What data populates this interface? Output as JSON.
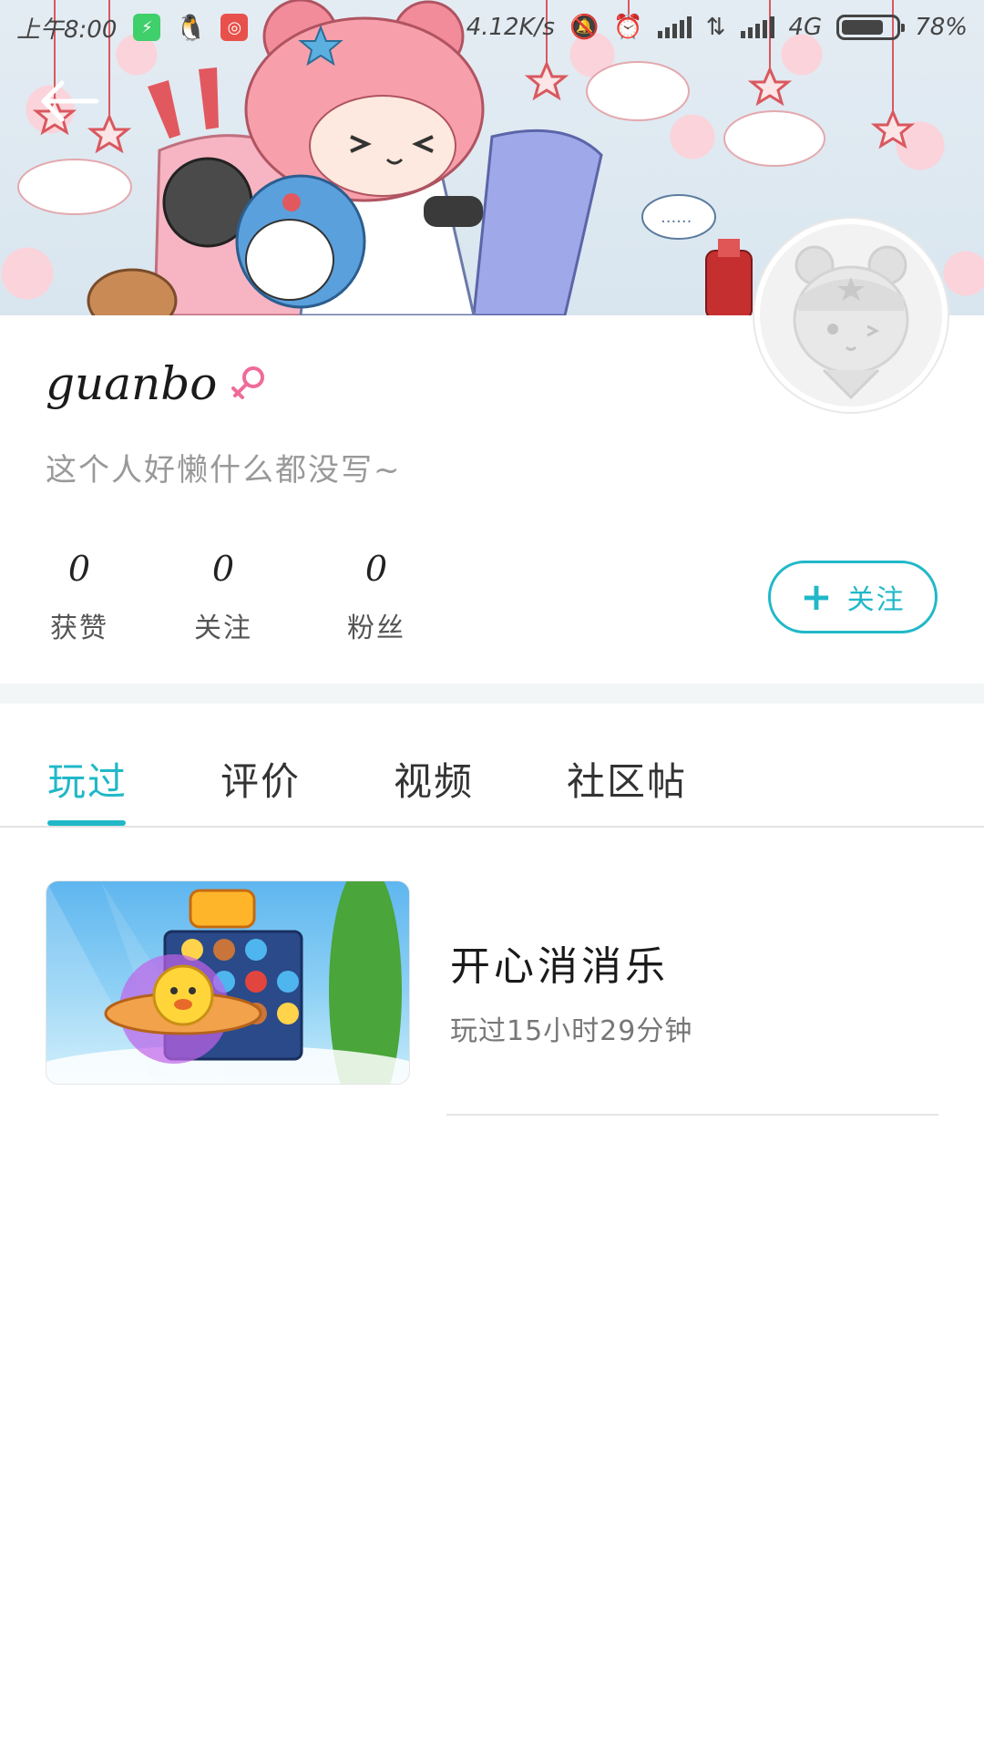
{
  "status_bar": {
    "time": "上午8:00",
    "net_speed": "4.12K/s",
    "network_type": "4G",
    "battery_percent": "78%",
    "battery_level": 0.78
  },
  "profile": {
    "username": "guanbo",
    "gender": "female",
    "bio": "这个人好懒什么都没写~",
    "stats": [
      {
        "value": "0",
        "label": "获赞"
      },
      {
        "value": "0",
        "label": "关注"
      },
      {
        "value": "0",
        "label": "粉丝"
      }
    ],
    "follow_label": "关注"
  },
  "tabs": [
    {
      "label": "玩过",
      "active": true
    },
    {
      "label": "评价",
      "active": false
    },
    {
      "label": "视频",
      "active": false
    },
    {
      "label": "社区帖",
      "active": false
    }
  ],
  "played_games": [
    {
      "title": "开心消消乐",
      "played_time": "玩过15小时29分钟"
    }
  ],
  "colors": {
    "accent": "#20b8c8",
    "gender_female": "#f06a9a"
  }
}
